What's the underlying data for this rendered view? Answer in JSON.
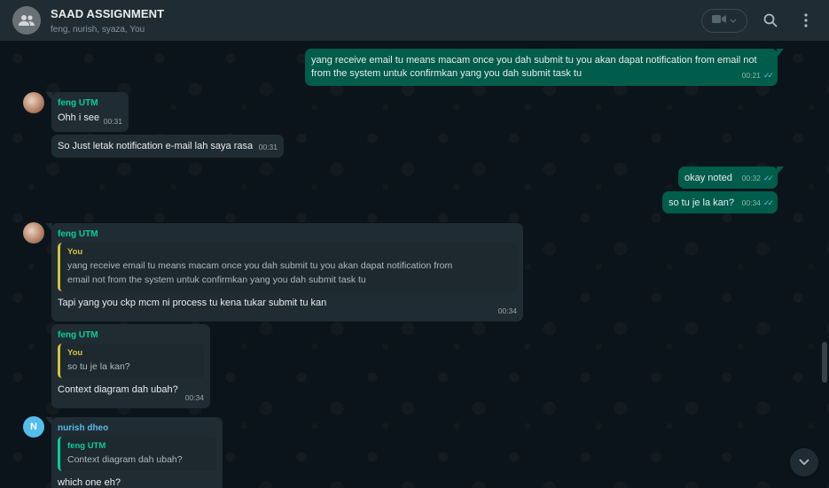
{
  "header": {
    "title": "SAAD ASSIGNMENT",
    "members": "feng, nurish, syaza, You",
    "icons": [
      "group-avatar-icon",
      "video-call-icon",
      "search-icon",
      "menu-icon"
    ]
  },
  "colors": {
    "incoming_bubble": "#202c33",
    "outgoing_bubble": "#005c4b",
    "sender_green": "#06cf9c",
    "sender_blue": "#53bdeb",
    "quote_you": "#d9c13d",
    "read_ticks": "#53bdeb"
  },
  "messages": [
    {
      "direction": "out",
      "text": "yang receive email tu means macam once you dah submit tu you akan dapat notification from email not from the system untuk confirmkan yang you dah submit task tu",
      "time": "00:21",
      "read": true
    },
    {
      "direction": "in",
      "sender": "feng UTM",
      "text": "Ohh i see",
      "time": "00:31"
    },
    {
      "direction": "in",
      "text": "So Just letak notification e-mail lah saya rasa",
      "time": "00:31"
    },
    {
      "direction": "out",
      "text": "okay noted",
      "time": "00:32",
      "read": true
    },
    {
      "direction": "out",
      "text": "so tu je la kan?",
      "time": "00:34",
      "read": true
    },
    {
      "direction": "in",
      "sender": "feng UTM",
      "quote_author": "You",
      "quote_text": "yang receive email tu means macam once you dah submit tu you akan dapat notification from email not from the system untuk confirmkan yang you dah submit task tu",
      "text": "Tapi yang you ckp mcm ni process tu kena tukar submit tu kan",
      "time": "00:34"
    },
    {
      "direction": "in",
      "sender": "feng UTM",
      "quote_author": "You",
      "quote_text": "so tu je la kan?",
      "text": "Context diagram dah ubah?",
      "time": "00:34"
    },
    {
      "direction": "in",
      "sender": "nurish dheo",
      "avatar_letter": "N",
      "quote_author": "feng UTM",
      "quote_text": "Context diagram dah ubah?",
      "text": "which one eh?",
      "time": ""
    }
  ]
}
